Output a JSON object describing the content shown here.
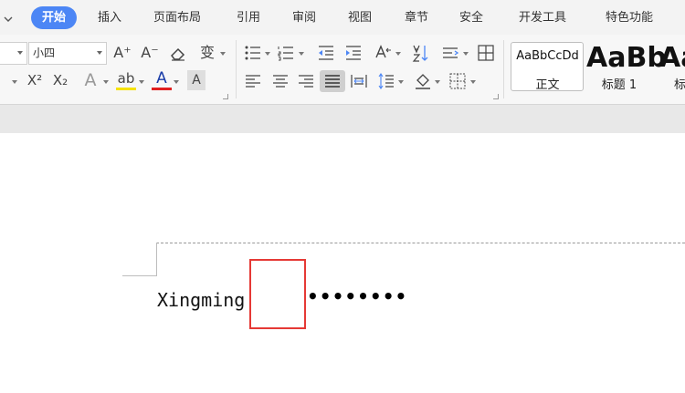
{
  "tabs": [
    {
      "label": "开始",
      "active": true
    },
    {
      "label": "插入"
    },
    {
      "label": "页面布局"
    },
    {
      "label": "引用"
    },
    {
      "label": "审阅"
    },
    {
      "label": "视图"
    },
    {
      "label": "章节"
    },
    {
      "label": "安全"
    },
    {
      "label": "开发工具"
    },
    {
      "label": "特色功能"
    }
  ],
  "font": {
    "size_value": "小四"
  },
  "icons": {
    "grow_font": "A⁺",
    "shrink_font": "A⁻",
    "superscript": "X²",
    "subscript": "X₂",
    "text_effect": "A",
    "highlight": "ab",
    "font_color": "A",
    "char_shading": "A",
    "phonetic": "变"
  },
  "styles": [
    {
      "sample": "AaBbCcDd",
      "name": "正文"
    },
    {
      "sample": "AaBb",
      "name": "标题 1"
    },
    {
      "sample": "Aa",
      "name": "标"
    }
  ],
  "document": {
    "text": "Xingming",
    "leader": "••••••••"
  },
  "colors": {
    "accent": "#4c86f5",
    "highlight_yellow": "#f5e200",
    "font_color_red": "#e02020",
    "selection_box": "#e53935"
  }
}
